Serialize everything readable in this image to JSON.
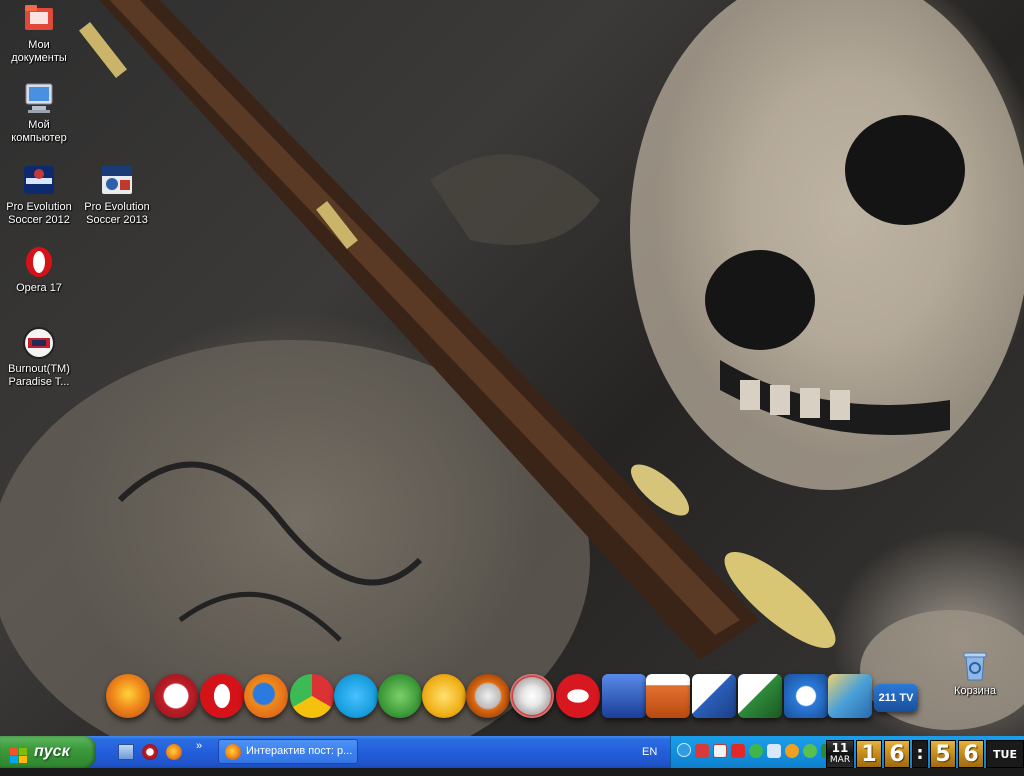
{
  "desktop": {
    "icons": [
      {
        "label": "Мои документы",
        "icon": "my-documents-folder-icon"
      },
      {
        "label": "Мой компьютер",
        "icon": "my-computer-icon"
      },
      {
        "label": "Pro Evolution Soccer 2012",
        "icon": "pes-2012-icon"
      },
      {
        "label": "Pro Evolution Soccer 2013",
        "icon": "pes-2013-icon"
      },
      {
        "label": "Opera 17",
        "icon": "opera-icon"
      },
      {
        "label": "Burnout(TM) Paradise T...",
        "icon": "burnout-paradise-icon"
      },
      {
        "label": "Корзина",
        "icon": "recycle-bin-icon"
      }
    ]
  },
  "dock": {
    "items": [
      {
        "icon": "firefox-icon",
        "color": "#e8681e"
      },
      {
        "icon": "media-player-icon",
        "color": "#c0202a"
      },
      {
        "icon": "opera-icon",
        "color": "#d41218"
      },
      {
        "icon": "firefox-alt-icon",
        "color": "#f08a1a"
      },
      {
        "icon": "chrome-icon",
        "color": "#3a9f3c"
      },
      {
        "icon": "skype-icon",
        "color": "#1aa0e0"
      },
      {
        "icon": "utorrent-icon",
        "color": "#3e9b3a"
      },
      {
        "icon": "v-app-icon",
        "color": "#f0b018"
      },
      {
        "icon": "nine-app-icon",
        "color": "#e06a10"
      },
      {
        "icon": "cd-burner-icon",
        "color": "#c8c8c8"
      },
      {
        "icon": "eye-app-icon",
        "color": "#d81820"
      },
      {
        "icon": "chart-app-icon",
        "color": "#2a5ab8"
      },
      {
        "icon": "powerpoint-icon",
        "color": "#e27030"
      },
      {
        "icon": "word-icon",
        "color": "#2b5fb8"
      },
      {
        "icon": "excel-icon",
        "color": "#2f8a3a"
      },
      {
        "icon": "hp-icon",
        "color": "#2a7ad8"
      },
      {
        "icon": "photo-app-icon",
        "color": "#4aa0d8"
      },
      {
        "icon": "211tv-icon",
        "color": "#1a5fb0",
        "label": "211 TV"
      }
    ]
  },
  "taskbar": {
    "start_label": "пуск",
    "quick_launch": [
      "show-desktop-icon",
      "media-player-icon",
      "firefox-icon"
    ],
    "more_label": "»",
    "task_title": "Интерактив пост: р...",
    "language": "EN",
    "tray_icons": [
      "network-icon",
      "antivirus-icon",
      "shield-icon",
      "connection-icon",
      "volume-icon",
      "update-icon",
      "chat-icon",
      "safety-icon",
      "bluetooth-icon",
      "utorrent-tray-icon"
    ]
  },
  "clock": {
    "day_num": "11",
    "month": "MAR",
    "h1": "1",
    "h2": "6",
    "colon": ":",
    "m1": "5",
    "m2": "6",
    "weekday": "TUE"
  }
}
